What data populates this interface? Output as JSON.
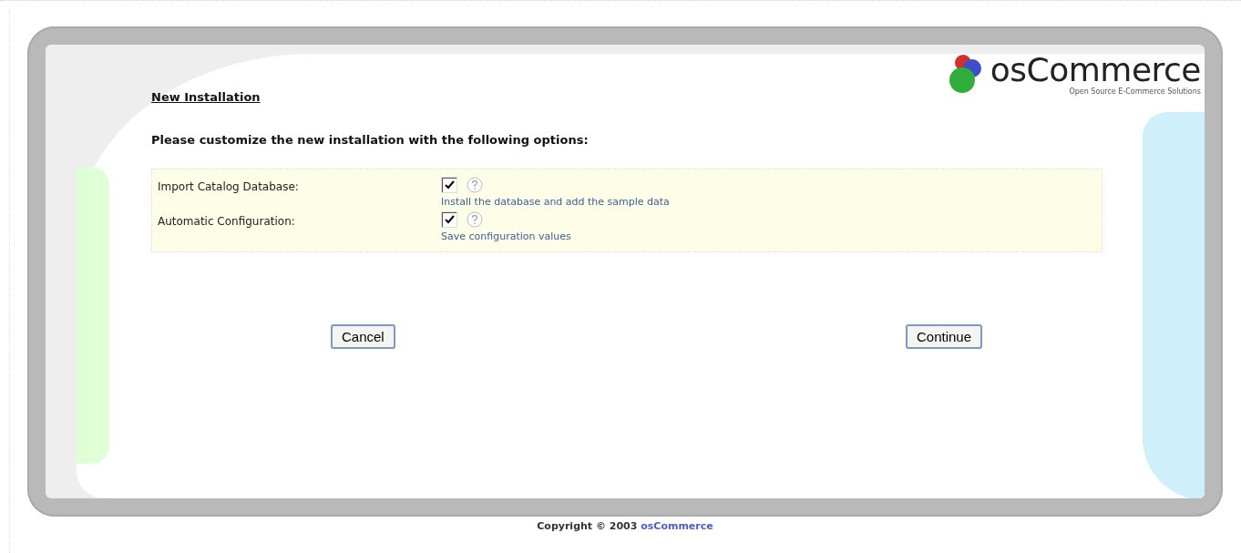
{
  "logo": {
    "name": "osCommerce",
    "tagline": "Open Source E-Commerce Solutions"
  },
  "heading": "New Installation",
  "instruction": "Please customize the new installation with the following options:",
  "options": [
    {
      "label": "Import Catalog Database:",
      "checked": true,
      "description": "Install the database and add the sample data"
    },
    {
      "label": "Automatic Configuration:",
      "checked": true,
      "description": "Save configuration values"
    }
  ],
  "buttons": [
    "Cancel",
    "Continue"
  ],
  "footer": {
    "text": "Copyright © 2003",
    "link": "osCommerce"
  }
}
